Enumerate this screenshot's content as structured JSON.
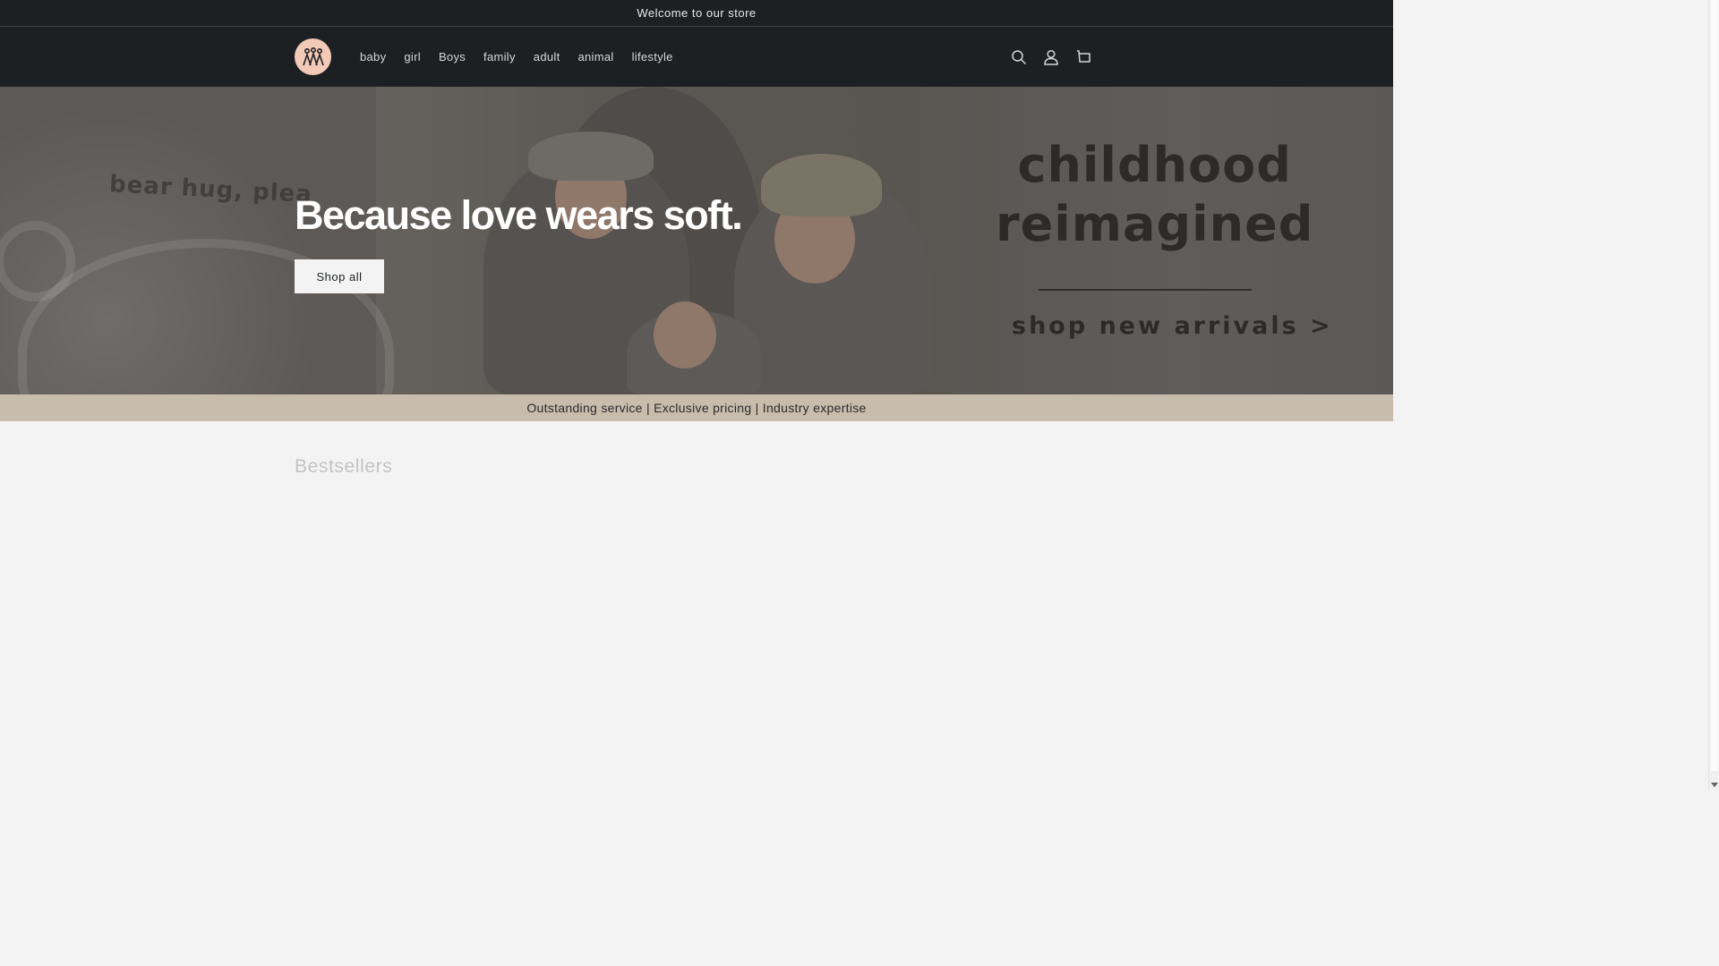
{
  "announcement": {
    "text": "Welcome to our store"
  },
  "header": {
    "logo_icon": "family-logo-icon",
    "nav": [
      {
        "label": "baby"
      },
      {
        "label": "girl"
      },
      {
        "label": "Boys"
      },
      {
        "label": "family"
      },
      {
        "label": "adult"
      },
      {
        "label": "animal"
      },
      {
        "label": "lifestyle"
      }
    ],
    "icons": [
      "search-icon",
      "account-icon",
      "cart-icon"
    ]
  },
  "hero": {
    "title": "Because love wears soft.",
    "button_label": "Shop all",
    "wall_text_left": "bear hug, plea",
    "wall_text_right_line1": "childhood",
    "wall_text_right_line2": "reimagined",
    "wall_text_arrivals": "shop new arrivals >"
  },
  "promo": {
    "text": "Outstanding service | Exclusive pricing | Industry expertise"
  },
  "bestsellers": {
    "title": "Bestsellers"
  },
  "colors": {
    "header_bg": "#1d2023",
    "promo_bg": "#c8bcad",
    "logo_bg": "#f3c9b8",
    "page_bg": "#f3f3f3"
  }
}
